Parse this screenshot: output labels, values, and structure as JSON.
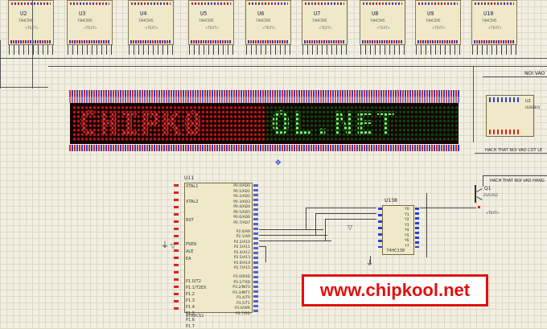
{
  "chips": {
    "labels": [
      "U2",
      "U3",
      "U4",
      "U5",
      "U6",
      "U7",
      "U8",
      "U9",
      "U10"
    ],
    "part": "74HC595",
    "text": "<TEXT>"
  },
  "display": {
    "red_text": "CHIPK0",
    "green_text": "OL.NET"
  },
  "mcu": {
    "label": "U11",
    "part": "AT89C52",
    "left_pins": [
      "XTAL1",
      "XTAL2",
      "RST",
      "PSEN",
      "ALE",
      "EA",
      "P1.0/T2",
      "P1.1/T2EX",
      "P1.2",
      "P1.3",
      "P1.4",
      "P1.5",
      "P1.6",
      "P1.7"
    ],
    "right_pins": [
      "P0.0/AD0",
      "P0.1/AD1",
      "P0.2/AD2",
      "P0.3/AD3",
      "P0.4/AD4",
      "P0.5/AD5",
      "P0.6/AD6",
      "P0.7/AD7",
      "P2.0/A8",
      "P2.1/A9",
      "P2.2/A10",
      "P2.3/A11",
      "P2.4/A12",
      "P2.5/A13",
      "P2.6/A14",
      "P2.7/A15",
      "P3.0/RXD",
      "P3.1/TXD",
      "P3.2/INT0",
      "P3.3/INT1",
      "P3.4/T0",
      "P3.5/T1",
      "P3.6/WR",
      "P3.7/RD"
    ]
  },
  "decoder": {
    "label": "U138",
    "part": "74HC138",
    "outputs": [
      "Y0",
      "Y1",
      "Y2",
      "Y3",
      "Y4",
      "Y5",
      "Y6",
      "Y7"
    ]
  },
  "right_chip": {
    "label": "U2",
    "part": "ULN2803"
  },
  "transistor": {
    "label": "Q1",
    "part": "2SA1012",
    "text": "<TEXT>"
  },
  "net_labels": {
    "top_right": "NOI VAO",
    "row_mid": "HACH THAT NOI VAO COT LE",
    "q_note": "HACH THAT NOI VAO HANG"
  },
  "banner": {
    "url": "www.chipkool.net",
    "color": "#e01010"
  }
}
